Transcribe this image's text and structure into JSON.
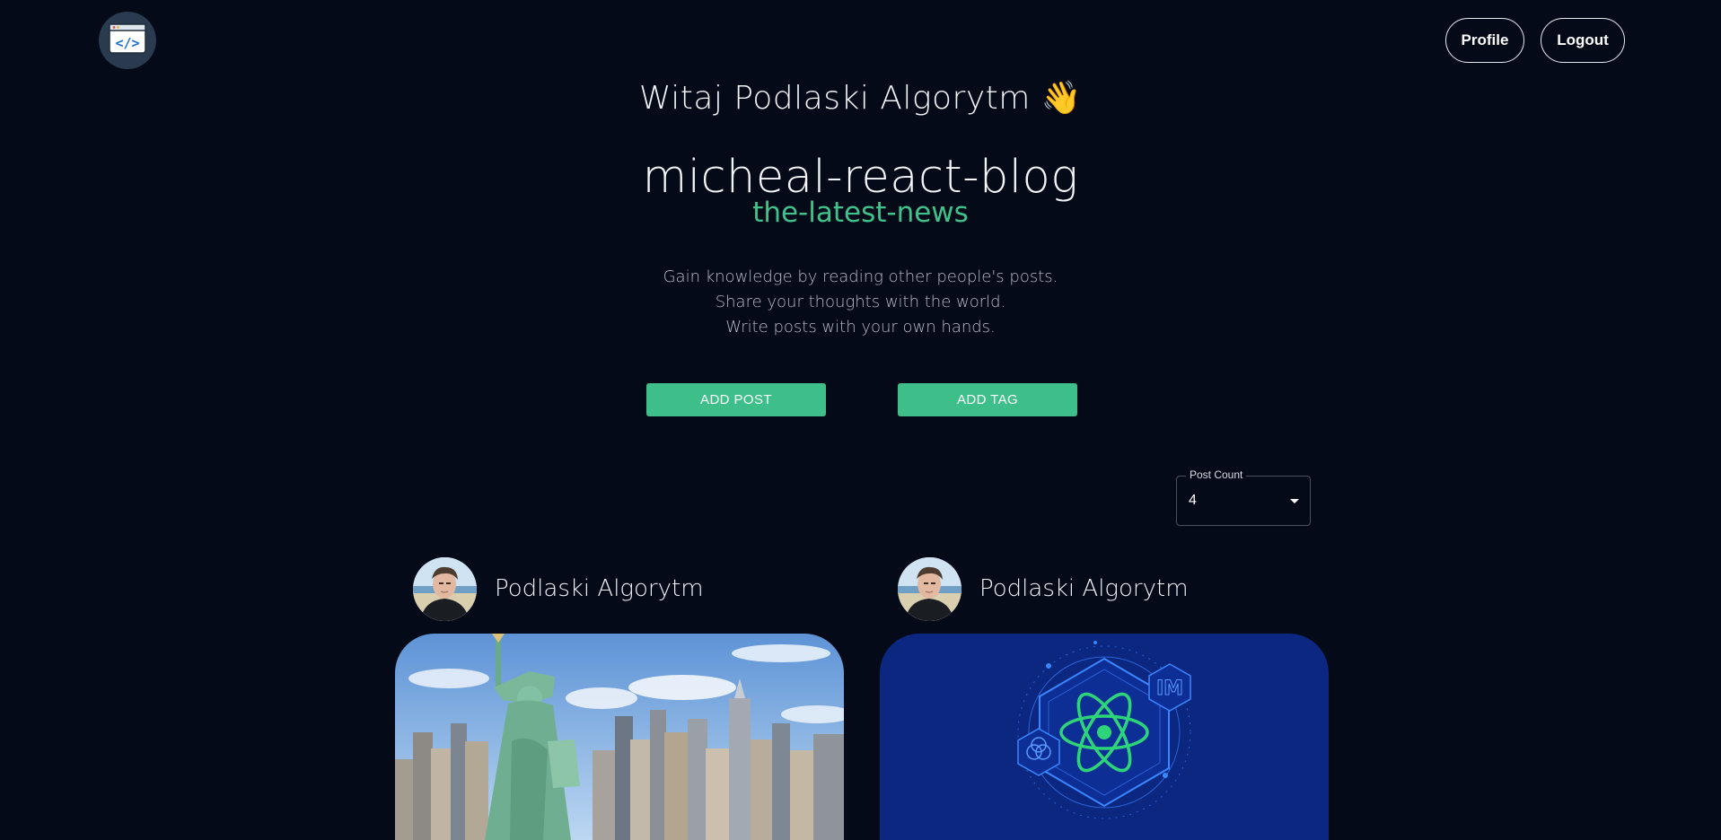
{
  "nav": {
    "logo_icon": "code-window-icon",
    "profile_label": "Profile",
    "logout_label": "Logout"
  },
  "hero": {
    "greeting": "Witaj Podlaski Algorytm 👋",
    "blog_title": "micheal-react-blog",
    "blog_subtitle": "the-latest-news",
    "intro_lines": [
      "Gain knowledge by reading other people's posts.",
      "Share your thoughts with the world.",
      "Write posts with your own hands."
    ]
  },
  "actions": {
    "add_post_label": "ADD POST",
    "add_tag_label": "ADD TAG"
  },
  "post_count": {
    "label": "Post Count",
    "value": "4"
  },
  "posts": [
    {
      "author": "Podlaski Algorytm",
      "image": "new-york-statue-of-liberty-photo"
    },
    {
      "author": "Podlaski Algorytm",
      "image": "react-atom-illustration"
    }
  ],
  "colors": {
    "background": "#050a18",
    "accent_green": "#3ebf89",
    "subtitle_green": "#3fc28b",
    "react_card_blue": "#0b2780"
  }
}
